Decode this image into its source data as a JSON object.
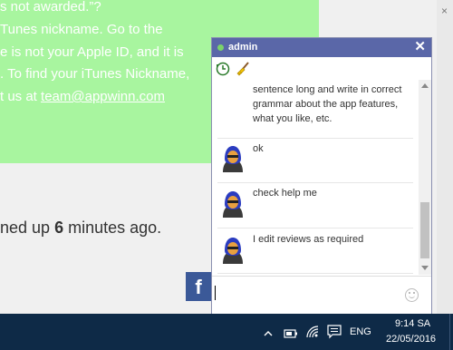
{
  "page": {
    "lines": [
      "s not awarded.”?",
      "Tunes nickname. Go to the",
      "e is not your Apple ID, and it is",
      ". To find your iTunes Nickname,",
      "t us at "
    ],
    "email": "team@appwinn.com",
    "signup_prefix": "ned up ",
    "signup_number": "6",
    "signup_suffix": " minutes ago.",
    "facebook_label": "f",
    "close_glyph": "×"
  },
  "chat": {
    "title": "admin",
    "close_glyph": "✕",
    "status_color": "#7bd36a",
    "tools": [
      "history-icon",
      "broom-icon"
    ],
    "messages": [
      {
        "avatar": "hooded-user-avatar",
        "text": "sentence long and write in correct grammar about the app features, what you like, etc."
      },
      {
        "avatar": "hooded-user-avatar",
        "text": "ok"
      },
      {
        "avatar": "hooded-user-avatar",
        "text": "check help me"
      },
      {
        "avatar": "hooded-user-avatar",
        "text": "I edit reviews as required"
      }
    ],
    "input_value": ""
  },
  "taskbar": {
    "language": "ENG",
    "time": "9:14 SA",
    "date": "22/05/2016",
    "tray_icons": [
      "chevron-up-icon",
      "battery-icon",
      "wifi-icon",
      "action-center-icon"
    ]
  },
  "colors": {
    "green_box": "#a8f59f",
    "chat_header": "#5a67a8",
    "taskbar": "#0e2a47",
    "facebook": "#3b5998"
  }
}
